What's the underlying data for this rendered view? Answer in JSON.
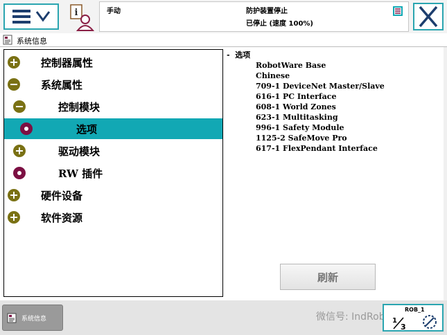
{
  "status": {
    "mode": "手动",
    "line1": "防护装置停止",
    "line2": "已停止 (速度 100%)"
  },
  "title": "系统信息",
  "tree": [
    {
      "label": "控制器属性",
      "icon": "plus-icon"
    },
    {
      "label": "系统属性",
      "icon": "minus-icon"
    },
    {
      "label": "控制模块",
      "icon": "minus-icon"
    },
    {
      "label": "选项",
      "icon": "dot-icon"
    },
    {
      "label": "驱动模块",
      "icon": "plus-icon"
    },
    {
      "label": "RW 插件",
      "icon": "dot-icon"
    },
    {
      "label": "硬件设备",
      "icon": "plus-icon"
    },
    {
      "label": "软件资源",
      "icon": "plus-icon"
    }
  ],
  "details": {
    "heading": "- 选项",
    "items": [
      "RobotWare Base",
      "Chinese",
      "709-1 DeviceNet Master/Slave",
      "616-1 PC Interface",
      "608-1 World Zones",
      "623-1 Multitasking",
      "996-1 Safety Module",
      "1125-2 SafeMove Pro",
      "617-1 FlexPendant Interface"
    ]
  },
  "refresh_label": "刷新",
  "taskbar": {
    "label": "系统信息"
  },
  "watermark": "微信号: IndRobSim",
  "rob": {
    "label": "ROB_1",
    "fraction": "1/3"
  },
  "colors": {
    "accent": "#12a8b4",
    "olive": "#7a7114",
    "maroon": "#7c1043"
  }
}
